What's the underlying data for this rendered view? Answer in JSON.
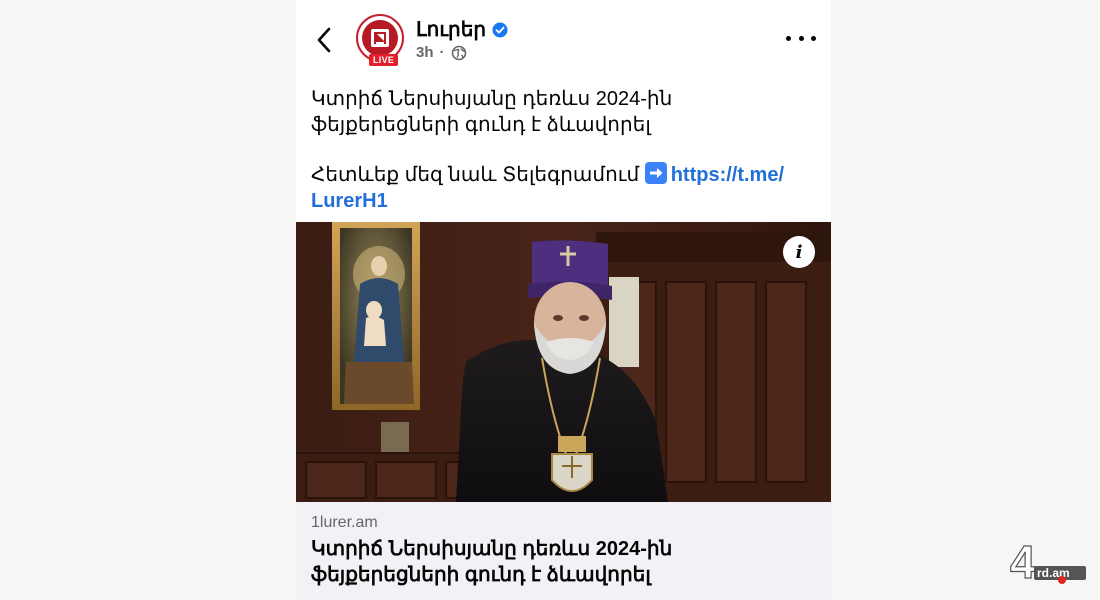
{
  "header": {
    "page_name": "Լուրեր",
    "time": "3h",
    "meta_separator": "·",
    "avatar_badge": "LIVE"
  },
  "post": {
    "title_line1": "Կտրիճ Ներսիսյանը դեռևս 2024-ին",
    "title_line2": "ֆեյքերեցների գունդ է ձևավորել",
    "follow_text": "Հետևեք մեզ նաև Տելեգրամում",
    "link_part1": "https://t.me/",
    "link_part2": "LurerH1"
  },
  "media": {
    "info_icon": "i"
  },
  "link_preview": {
    "domain": "1lurer.am",
    "title_line1": "Կտրիճ Ներսիսյանը դեռևս 2024-ին",
    "title_line2": "ֆեյքերեցների գունդ է ձևավորել"
  },
  "watermark": {
    "text_main": "4",
    "text_suffix": "rd.am"
  },
  "colors": {
    "link": "#216fdb",
    "verified": "#1877f2",
    "live_badge": "#e41e2b",
    "preview_bg": "#f0f2f5"
  }
}
